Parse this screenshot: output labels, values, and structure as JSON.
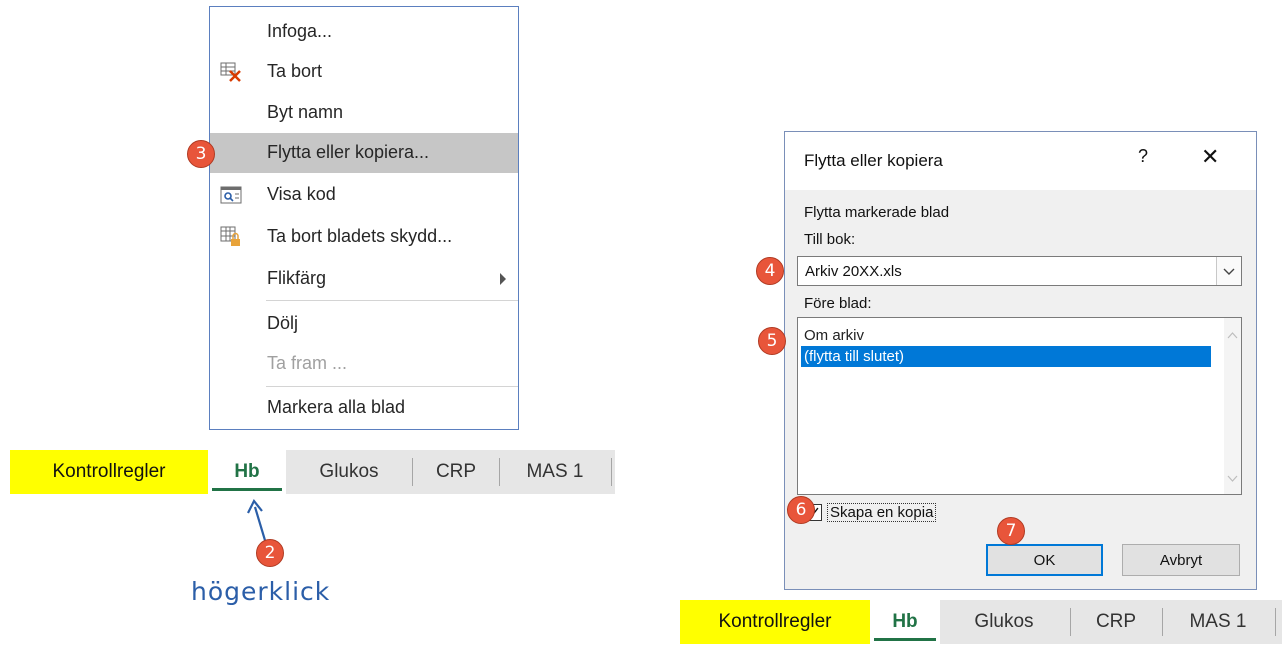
{
  "context_menu": {
    "items": [
      {
        "label": "Infoga...",
        "icon": "",
        "disabled": false
      },
      {
        "label": "Ta bort",
        "icon": "delete-sheet-icon",
        "disabled": false
      },
      {
        "label": "Byt namn",
        "icon": "",
        "disabled": false
      },
      {
        "label": "Flytta eller kopiera...",
        "icon": "",
        "disabled": false,
        "highlighted": true
      },
      {
        "label": "Visa kod",
        "icon": "view-code-icon",
        "disabled": false
      },
      {
        "label": "Ta bort bladets skydd...",
        "icon": "unprotect-sheet-icon",
        "disabled": false
      },
      {
        "label": "Flikfärg",
        "icon": "",
        "disabled": false,
        "submenu": true
      },
      {
        "label": "Dölj",
        "icon": "",
        "disabled": false
      },
      {
        "label": "Ta fram ...",
        "icon": "",
        "disabled": true
      },
      {
        "label": "Markera alla blad",
        "icon": "",
        "disabled": false
      }
    ]
  },
  "sheet_tabs": [
    {
      "label": "Kontrollregler",
      "style": "yellow"
    },
    {
      "label": "Hb",
      "style": "active"
    },
    {
      "label": "Glukos",
      "style": "normal"
    },
    {
      "label": "CRP",
      "style": "normal"
    },
    {
      "label": "MAS 1",
      "style": "normal"
    }
  ],
  "annotations": {
    "step2": "2",
    "step3": "3",
    "step4": "4",
    "step5": "5",
    "step6": "6",
    "step7": "7",
    "handwritten": "högerklick"
  },
  "dialog": {
    "title": "Flytta eller kopiera",
    "help": "?",
    "close": "✕",
    "move_label": "Flytta markerade blad",
    "to_book_label": "Till bok:",
    "to_book_value": "Arkiv 20XX.xls",
    "before_sheet_label": "Före blad:",
    "before_sheet_items": [
      "Om arkiv",
      "(flytta till slutet)"
    ],
    "selected_index": 1,
    "copy_label": "Skapa en kopia",
    "copy_checked": true,
    "ok_label": "OK",
    "cancel_label": "Avbryt"
  },
  "colors": {
    "excel_green": "#217346",
    "selection_blue": "#0078d7",
    "badge_red": "#e8553a",
    "highlight_yellow": "#ffff00"
  }
}
